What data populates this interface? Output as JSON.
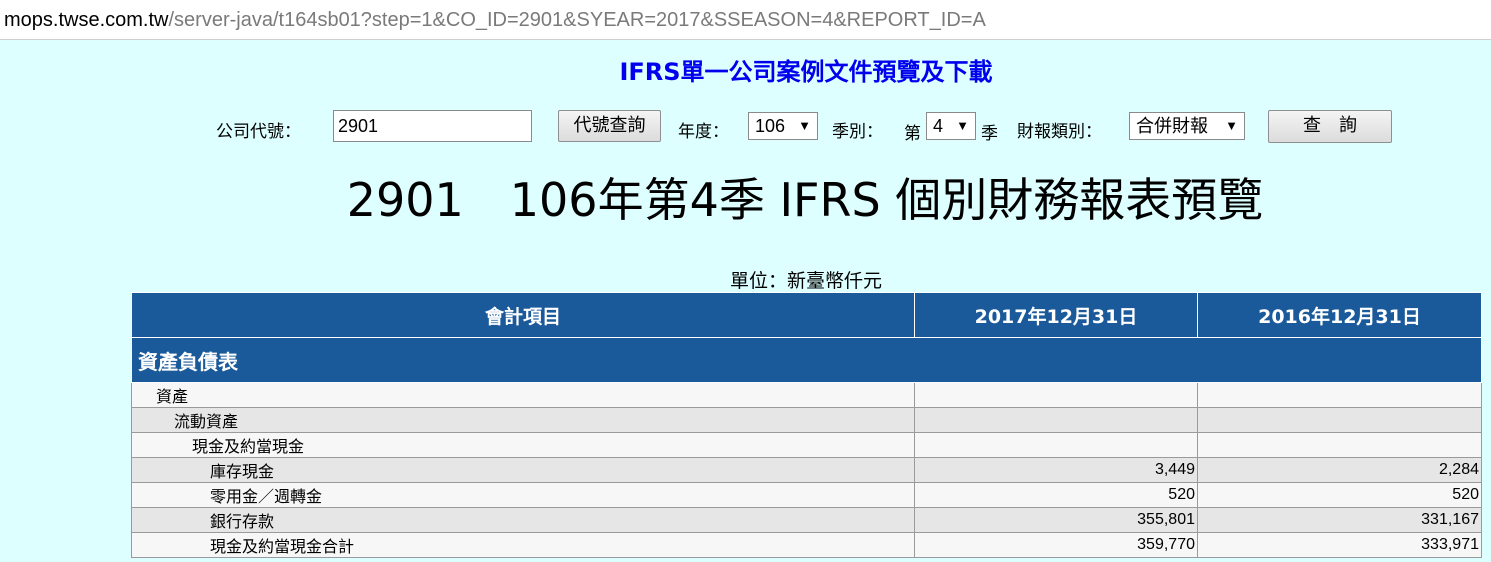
{
  "browser": {
    "url_host": "mops.twse.com.tw",
    "url_path": "/server-java/t164sb01?step=1&CO_ID=2901&SYEAR=2017&SSEASON=4&REPORT_ID=A"
  },
  "page": {
    "heading": "IFRS單一公司案例文件預覽及下載"
  },
  "form": {
    "company_code_label": "公司代號：",
    "company_code_value": "2901",
    "code_lookup_button": "代號查詢",
    "year_label": "年度：",
    "year_value": "106",
    "season_label": "季別：",
    "season_prefix": "第",
    "season_value": "4",
    "season_suffix": "季",
    "report_type_label": "財報類別：",
    "report_type_value": "合併財報",
    "query_button": "查　詢"
  },
  "report": {
    "title": "2901　106年第4季 IFRS 個別財務報表預覽",
    "unit": "單位：新臺幣仟元",
    "columns": [
      "會計項目",
      "2017年12月31日",
      "2016年12月31日"
    ],
    "section": "資產負債表",
    "rows": [
      {
        "item": "資產",
        "indent": 1,
        "v2017": "",
        "v2016": ""
      },
      {
        "item": "流動資產",
        "indent": 2,
        "v2017": "",
        "v2016": ""
      },
      {
        "item": "現金及約當現金",
        "indent": 3,
        "v2017": "",
        "v2016": ""
      },
      {
        "item": "庫存現金",
        "indent": 4,
        "v2017": "3,449",
        "v2016": "2,284"
      },
      {
        "item": "零用金／週轉金",
        "indent": 4,
        "v2017": "520",
        "v2016": "520"
      },
      {
        "item": "銀行存款",
        "indent": 4,
        "v2017": "355,801",
        "v2016": "331,167"
      },
      {
        "item": "現金及約當現金合計",
        "indent": 4,
        "v2017": "359,770",
        "v2016": "333,971"
      }
    ]
  },
  "colors": {
    "page_background": "#ddffff",
    "table_header": "#1b5a9a",
    "heading_link": "#0000ee"
  }
}
